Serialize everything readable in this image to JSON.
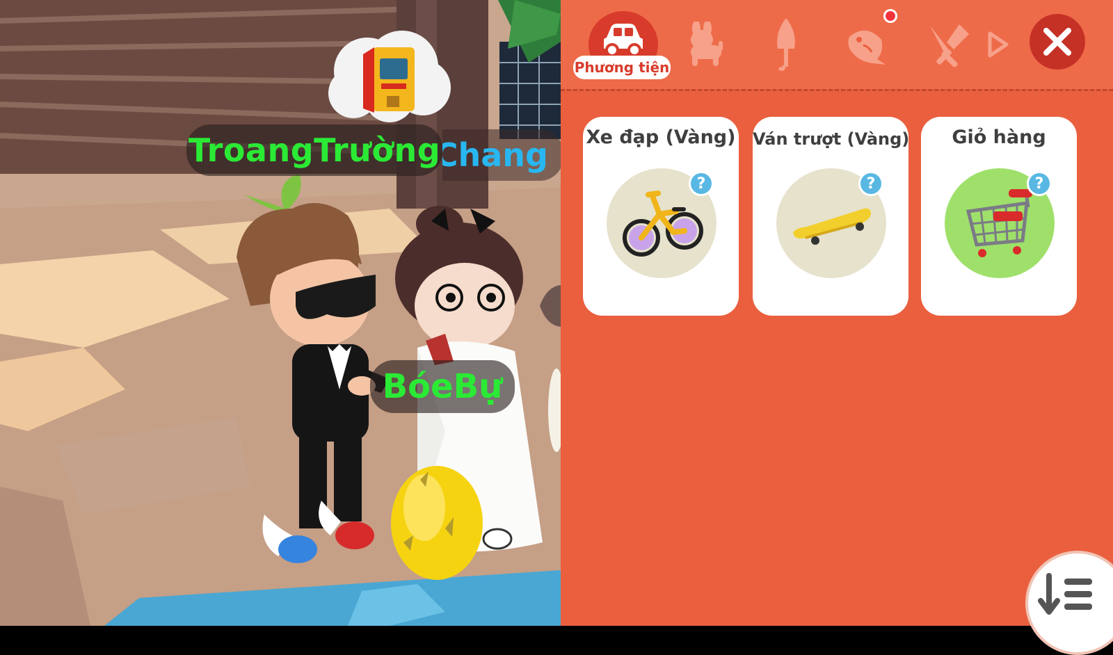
{
  "world": {
    "player_name": "TroangTrường",
    "other_player_name_partial": "nChang",
    "pet_name": "BóeBự",
    "thought_icon": "arcade-machine-icon",
    "colors": {
      "player_name": "#2bea35",
      "other_name": "#28b7f0"
    }
  },
  "shop": {
    "tabs": [
      {
        "icon": "car-icon",
        "label": "Phương tiện",
        "active": true
      },
      {
        "icon": "pet-dog-icon",
        "active": false
      },
      {
        "icon": "umbrella-icon",
        "active": false
      },
      {
        "icon": "fish-icon",
        "active": false,
        "notification": true
      },
      {
        "icon": "fork-knife-icon",
        "active": false
      }
    ],
    "next_icon": "play-arrow-icon",
    "close_icon": "close-icon",
    "items": [
      {
        "title": "Xe đạp (Vàng)",
        "icon": "bicycle-icon",
        "bg": "#e6e2cc"
      },
      {
        "title": "Ván trượt (Vàng)",
        "icon": "skateboard-icon",
        "bg": "#e6e2cc"
      },
      {
        "title": "Giỏ hàng",
        "icon": "shopping-cart-icon",
        "bg": "#9fe06a"
      }
    ],
    "help_label": "?",
    "sort_icon": "sort-down-icon",
    "colors": {
      "panel": "#ea5f3e",
      "active_tab": "#d83b2b",
      "close": "#c63126"
    }
  }
}
